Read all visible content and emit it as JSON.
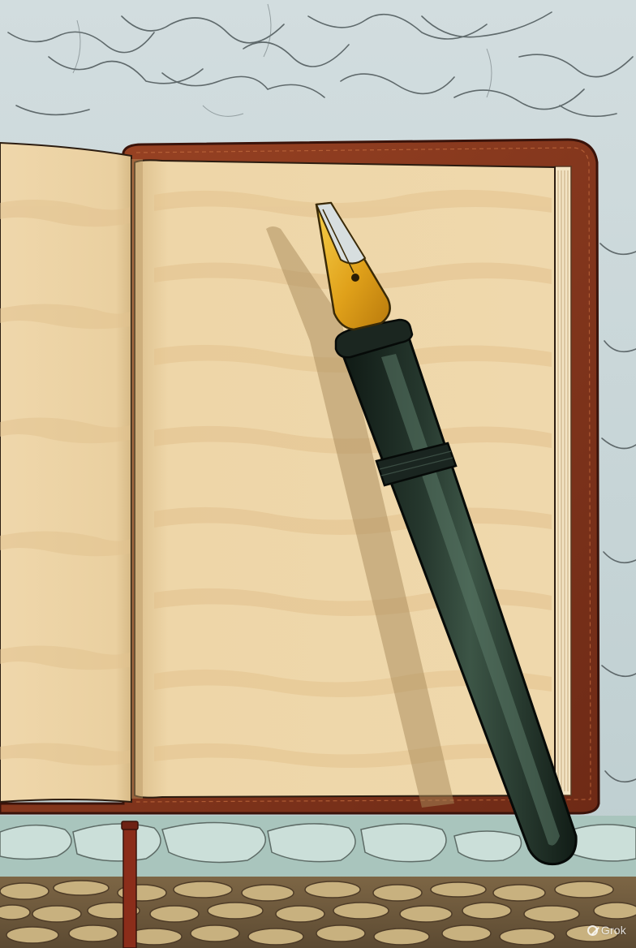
{
  "scene": {
    "subject": "open-notebook-with-fountain-pen",
    "colors": {
      "wall_base": "#c8d6d8",
      "wall_vein": "#4c5658",
      "ledge": "#a8c6be",
      "ledge_stone": "#c9ded9",
      "floor_base": "#6e5a3e",
      "floor_stone": "#c7b07e",
      "page_base": "#efd8ad",
      "page_shade": "#e6c28c",
      "leather": "#8a3a1f",
      "leather_edge": "#3a130a",
      "pen_body": "#1e2d25",
      "pen_highlight": "#5b7a68",
      "nib_gold": "#e4ad1b",
      "nib_silver": "#d7dedf",
      "ribbon": "#8b2d1a"
    }
  },
  "watermark": {
    "text": "Grok"
  }
}
